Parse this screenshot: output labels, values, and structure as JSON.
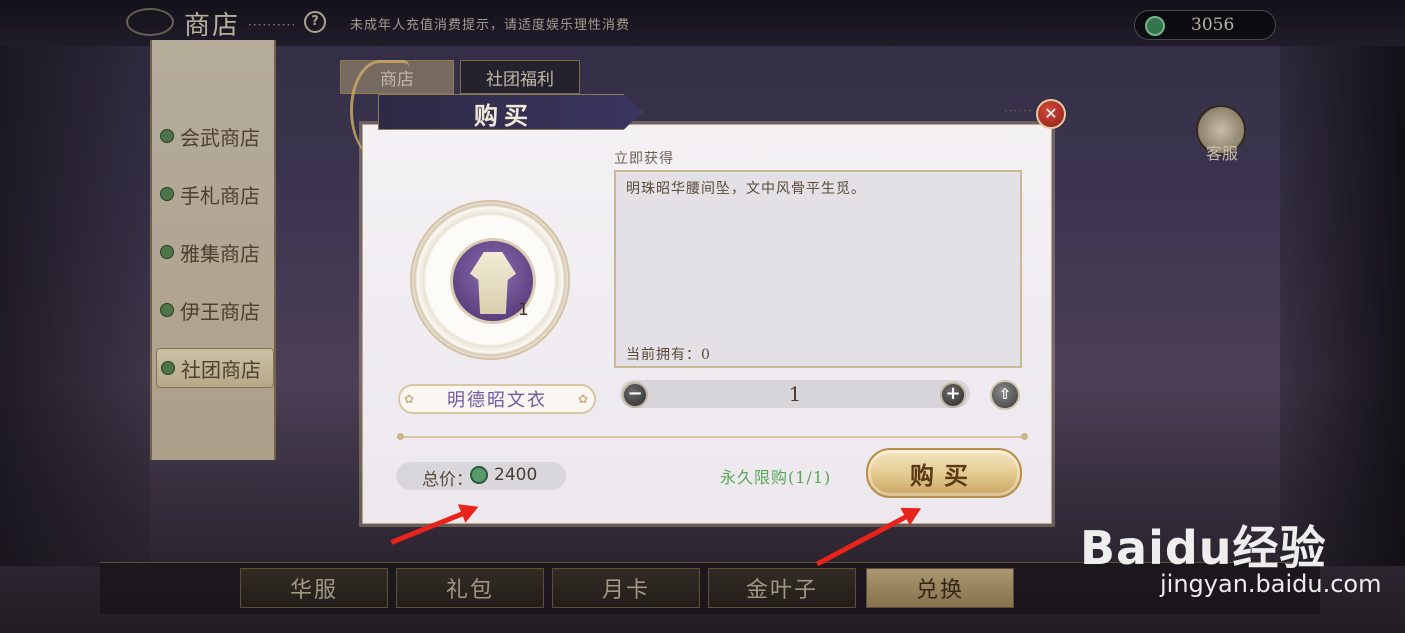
{
  "topbar": {
    "title": "商店",
    "notice": "未成年人充值消费提示，请适度娱乐理性消费",
    "currency_value": "3056",
    "currency_icon": "jade-coin-icon"
  },
  "top_tabs": {
    "shop": "商店",
    "club_welfare": "社团福利"
  },
  "sidebar": {
    "items": [
      {
        "label": "会武商店",
        "icon": "leaf-icon"
      },
      {
        "label": "手札商店",
        "icon": "flower-icon"
      },
      {
        "label": "雅集商店",
        "icon": "vase-icon"
      },
      {
        "label": "伊王商店",
        "icon": "lantern-icon"
      },
      {
        "label": "社团商店",
        "icon": "flag-icon",
        "active": true
      }
    ]
  },
  "customer_service": "客服",
  "bottom_tabs": [
    {
      "label": "华服",
      "active": false
    },
    {
      "label": "礼包",
      "active": false
    },
    {
      "label": "月卡",
      "active": false
    },
    {
      "label": "金叶子",
      "active": false
    },
    {
      "label": "兑换",
      "active": true
    }
  ],
  "modal": {
    "title": "购买",
    "section_label": "立即获得",
    "description": "明珠昭华腰间坠，文中风骨平生觅。",
    "owned": "当前拥有：0",
    "item_name": "明德昭文衣",
    "item_count": "1",
    "quantity": "1",
    "total_label": "总价：",
    "total_value": "2400",
    "limit_text": "永久限购(1/1)",
    "buy_button": "购买"
  },
  "watermark": {
    "logo": "Baidu经验",
    "url": "jingyan.baidu.com"
  },
  "colors": {
    "accent_red": "#e8231c",
    "limit_green": "#5aa75a",
    "item_name_purple": "#6e5aa4",
    "buy_gold": "#e3c88d"
  }
}
